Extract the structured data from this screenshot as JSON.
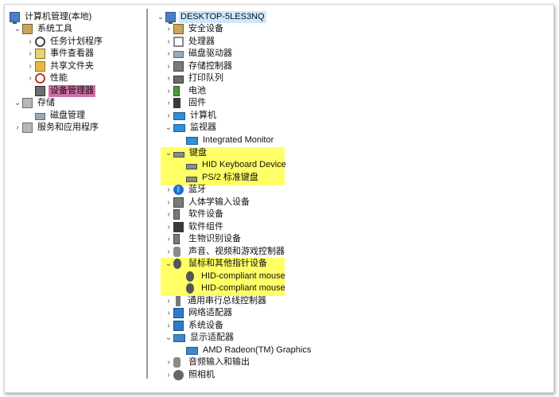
{
  "left_tree": {
    "root": "计算机管理(本地)",
    "system_tools": "系统工具",
    "task_scheduler": "任务计划程序",
    "event_viewer": "事件查看器",
    "shared_folders": "共享文件夹",
    "performance": "性能",
    "device_manager": "设备管理器",
    "storage": "存储",
    "disk_management": "磁盘管理",
    "services_apps": "服务和应用程序"
  },
  "device_tree": {
    "computer_name": "DESKTOP-5LES3NQ",
    "security_devices": "安全设备",
    "processors": "处理器",
    "disk_drives": "磁盘驱动器",
    "storage_controllers": "存储控制器",
    "print_queues": "打印队列",
    "batteries": "电池",
    "firmware": "固件",
    "computer": "计算机",
    "monitors": "监视器",
    "integrated_monitor": "Integrated Monitor",
    "keyboards": "键盘",
    "hid_keyboard": "HID Keyboard Device",
    "ps2_keyboard": "PS/2 标准键盘",
    "bluetooth": "蓝牙",
    "hid": "人体学输入设备",
    "software_devices": "软件设备",
    "software_components": "软件组件",
    "biometric": "生物识别设备",
    "sound": "声音、视频和游戏控制器",
    "mice": "鼠标和其他指针设备",
    "hid_mouse_1": "HID-compliant mouse",
    "hid_mouse_2": "HID-compliant mouse",
    "usb": "通用串行总线控制器",
    "network": "网络适配器",
    "system_devices": "系统设备",
    "display": "显示适配器",
    "gpu": "AMD Radeon(TM) Graphics",
    "audio_io": "音频输入和输出",
    "cameras": "照相机"
  },
  "colors": {
    "device_manager_highlight": "#d26fa6",
    "yellow_highlight": "#ffff66",
    "selected_computer": "#cce8ff"
  }
}
